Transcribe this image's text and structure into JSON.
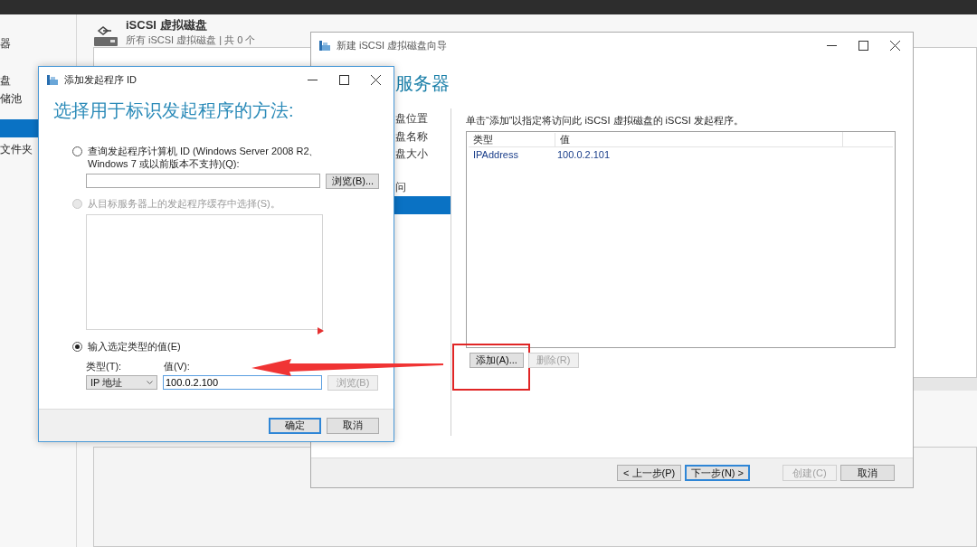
{
  "server_manager": {
    "sidebar": {
      "items": [
        {
          "label": "器",
          "selected": false
        },
        {
          "label": "盘",
          "selected": false
        },
        {
          "label": "储池",
          "selected": false
        },
        {
          "selected": true
        },
        {
          "label": "文件夹",
          "selected": false
        }
      ]
    },
    "section": {
      "title": "iSCSI 虚拟磁盘",
      "subtitle": "所有 iSCSI 虚拟磁盘 | 共 0 个"
    }
  },
  "wizard": {
    "title": "新建 iSCSI 虚拟磁盘向导",
    "heading": "服务器",
    "steps": [
      {
        "label": "盘位置",
        "selected": false
      },
      {
        "label": "盘名称",
        "selected": false
      },
      {
        "label": "盘大小",
        "selected": false
      },
      {
        "label": "问",
        "selected": false
      },
      {
        "selected": true
      }
    ],
    "instruction": "单击“添加”以指定将访问此 iSCSI 虚拟磁盘的 iSCSI 发起程序。",
    "table": {
      "columns": [
        "类型",
        "值"
      ],
      "rows": [
        [
          "IPAddress",
          "100.0.2.101"
        ]
      ]
    },
    "actions": [
      {
        "label": "添加(A)...",
        "disabled": false,
        "highlighted": true
      },
      {
        "label": "删除(R)",
        "disabled": true,
        "highlighted": false
      }
    ],
    "footer": [
      {
        "label": "< 上一步(P)",
        "disabled": false,
        "default": false
      },
      {
        "label": "下一步(N) >",
        "disabled": false,
        "default": true
      },
      {
        "label": "创建(C)",
        "disabled": true,
        "default": false
      },
      {
        "label": "取消",
        "disabled": false,
        "default": false
      }
    ]
  },
  "dialog": {
    "title": "添加发起程序 ID",
    "heading": "选择用于标识发起程序的方法:",
    "options": [
      {
        "kind": "query",
        "label": "查询发起程序计算机 ID (Windows Server 2008 R2、Windows 7 或以前版本不支持)(Q):",
        "selected": false,
        "disabled": false,
        "browse": {
          "label": "浏览(B)...",
          "disabled": false
        }
      },
      {
        "kind": "cache",
        "label": "从目标服务器上的发起程序缓存中选择(S)。",
        "selected": false,
        "disabled": true
      },
      {
        "kind": "value",
        "label": "输入选定类型的值(E)",
        "selected": true,
        "disabled": false,
        "type_label": "类型(T):",
        "value_label": "值(V):",
        "type_value": "IP 地址",
        "value": "100.0.2.100",
        "browse": {
          "label": "浏览(B)",
          "disabled": true
        }
      }
    ],
    "footer": [
      {
        "label": "确定",
        "default": true
      },
      {
        "label": "取消",
        "default": false
      }
    ]
  }
}
